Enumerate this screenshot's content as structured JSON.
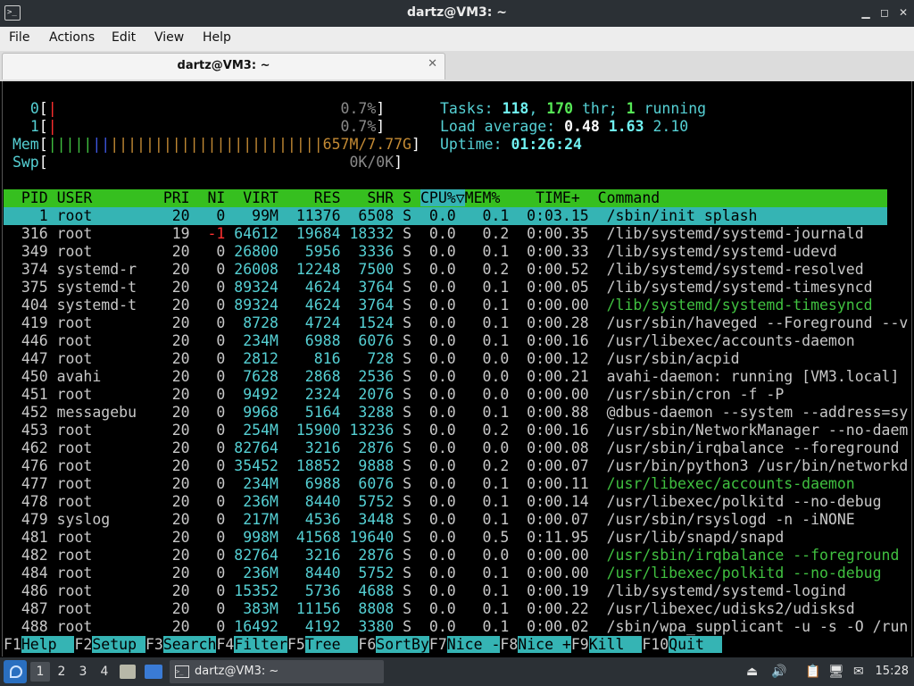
{
  "window": {
    "title": "dartz@VM3: ~",
    "icon": "terminal-icon",
    "minimize_glyph": "▁",
    "maximize_glyph": "◻",
    "close_glyph": "✕"
  },
  "menu": [
    "File",
    "Actions",
    "Edit",
    "View",
    "Help"
  ],
  "tab": {
    "label": "dartz@VM3: ~",
    "close_glyph": "✕"
  },
  "htop": {
    "cpu": [
      {
        "label": "0",
        "value": "0.7%"
      },
      {
        "label": "1",
        "value": "0.7%"
      }
    ],
    "mem": {
      "label": "Mem",
      "bar": "||||||||||||||||||||||||||||||||||||||",
      "value": "657M/7.77G"
    },
    "swp": {
      "label": "Swp",
      "value": "0K/0K"
    },
    "tasks": {
      "label": "Tasks: ",
      "count": "118",
      "threads": "170",
      "thr_label": " thr; ",
      "running": "1",
      "running_label": " running"
    },
    "load": {
      "label": "Load average: ",
      "one": "0.48",
      "five": "1.63",
      "fifteen": "2.10"
    },
    "uptime": {
      "label": "Uptime: ",
      "value": "01:26:24"
    },
    "columns": [
      "PID",
      "USER",
      "PRI",
      "NI",
      "VIRT",
      "RES",
      "SHR",
      "S",
      "CPU%",
      "MEM%",
      "TIME+",
      "Command"
    ],
    "sort_marker": "▽",
    "processes": [
      {
        "pid": "1",
        "user": "root",
        "pri": "20",
        "ni": "0",
        "virt": "99M",
        "res": "11376",
        "shr": "6508",
        "s": "S",
        "cpu": "0.0",
        "mem": "0.1",
        "time": "0:03.15",
        "cmd": "/sbin/init splash",
        "selected": true
      },
      {
        "pid": "316",
        "user": "root",
        "pri": "19",
        "ni": "-1",
        "virt": "64612",
        "res": "19684",
        "shr": "18332",
        "s": "S",
        "cpu": "0.0",
        "mem": "0.2",
        "time": "0:00.35",
        "cmd": "/lib/systemd/systemd-journald"
      },
      {
        "pid": "349",
        "user": "root",
        "pri": "20",
        "ni": "0",
        "virt": "26800",
        "res": "5956",
        "shr": "3336",
        "s": "S",
        "cpu": "0.0",
        "mem": "0.1",
        "time": "0:00.33",
        "cmd": "/lib/systemd/systemd-udevd"
      },
      {
        "pid": "374",
        "user": "systemd-r",
        "pri": "20",
        "ni": "0",
        "virt": "26008",
        "res": "12248",
        "shr": "7500",
        "s": "S",
        "cpu": "0.0",
        "mem": "0.2",
        "time": "0:00.52",
        "cmd": "/lib/systemd/systemd-resolved"
      },
      {
        "pid": "375",
        "user": "systemd-t",
        "pri": "20",
        "ni": "0",
        "virt": "89324",
        "res": "4624",
        "shr": "3764",
        "s": "S",
        "cpu": "0.0",
        "mem": "0.1",
        "time": "0:00.05",
        "cmd": "/lib/systemd/systemd-timesyncd"
      },
      {
        "pid": "404",
        "user": "systemd-t",
        "pri": "20",
        "ni": "0",
        "virt": "89324",
        "res": "4624",
        "shr": "3764",
        "s": "S",
        "cpu": "0.0",
        "mem": "0.1",
        "time": "0:00.00",
        "cmd": "/lib/systemd/systemd-timesyncd",
        "thread": true
      },
      {
        "pid": "419",
        "user": "root",
        "pri": "20",
        "ni": "0",
        "virt": "8728",
        "res": "4724",
        "shr": "1524",
        "s": "S",
        "cpu": "0.0",
        "mem": "0.1",
        "time": "0:00.28",
        "cmd": "/usr/sbin/haveged --Foreground --v"
      },
      {
        "pid": "446",
        "user": "root",
        "pri": "20",
        "ni": "0",
        "virt": "234M",
        "res": "6988",
        "shr": "6076",
        "s": "S",
        "cpu": "0.0",
        "mem": "0.1",
        "time": "0:00.16",
        "cmd": "/usr/libexec/accounts-daemon"
      },
      {
        "pid": "447",
        "user": "root",
        "pri": "20",
        "ni": "0",
        "virt": "2812",
        "res": "816",
        "shr": "728",
        "s": "S",
        "cpu": "0.0",
        "mem": "0.0",
        "time": "0:00.12",
        "cmd": "/usr/sbin/acpid"
      },
      {
        "pid": "450",
        "user": "avahi",
        "pri": "20",
        "ni": "0",
        "virt": "7628",
        "res": "2868",
        "shr": "2536",
        "s": "S",
        "cpu": "0.0",
        "mem": "0.0",
        "time": "0:00.21",
        "cmd": "avahi-daemon: running [VM3.local]"
      },
      {
        "pid": "451",
        "user": "root",
        "pri": "20",
        "ni": "0",
        "virt": "9492",
        "res": "2324",
        "shr": "2076",
        "s": "S",
        "cpu": "0.0",
        "mem": "0.0",
        "time": "0:00.00",
        "cmd": "/usr/sbin/cron -f -P"
      },
      {
        "pid": "452",
        "user": "messagebu",
        "pri": "20",
        "ni": "0",
        "virt": "9968",
        "res": "5164",
        "shr": "3288",
        "s": "S",
        "cpu": "0.0",
        "mem": "0.1",
        "time": "0:00.88",
        "cmd": "@dbus-daemon --system --address=sy"
      },
      {
        "pid": "453",
        "user": "root",
        "pri": "20",
        "ni": "0",
        "virt": "254M",
        "res": "15900",
        "shr": "13236",
        "s": "S",
        "cpu": "0.0",
        "mem": "0.2",
        "time": "0:00.16",
        "cmd": "/usr/sbin/NetworkManager --no-daem"
      },
      {
        "pid": "462",
        "user": "root",
        "pri": "20",
        "ni": "0",
        "virt": "82764",
        "res": "3216",
        "shr": "2876",
        "s": "S",
        "cpu": "0.0",
        "mem": "0.0",
        "time": "0:00.08",
        "cmd": "/usr/sbin/irqbalance --foreground"
      },
      {
        "pid": "476",
        "user": "root",
        "pri": "20",
        "ni": "0",
        "virt": "35452",
        "res": "18852",
        "shr": "9888",
        "s": "S",
        "cpu": "0.0",
        "mem": "0.2",
        "time": "0:00.07",
        "cmd": "/usr/bin/python3 /usr/bin/networkd"
      },
      {
        "pid": "477",
        "user": "root",
        "pri": "20",
        "ni": "0",
        "virt": "234M",
        "res": "6988",
        "shr": "6076",
        "s": "S",
        "cpu": "0.0",
        "mem": "0.1",
        "time": "0:00.11",
        "cmd": "/usr/libexec/accounts-daemon",
        "thread": true
      },
      {
        "pid": "478",
        "user": "root",
        "pri": "20",
        "ni": "0",
        "virt": "236M",
        "res": "8440",
        "shr": "5752",
        "s": "S",
        "cpu": "0.0",
        "mem": "0.1",
        "time": "0:00.14",
        "cmd": "/usr/libexec/polkitd --no-debug"
      },
      {
        "pid": "479",
        "user": "syslog",
        "pri": "20",
        "ni": "0",
        "virt": "217M",
        "res": "4536",
        "shr": "3448",
        "s": "S",
        "cpu": "0.0",
        "mem": "0.1",
        "time": "0:00.07",
        "cmd": "/usr/sbin/rsyslogd -n -iNONE"
      },
      {
        "pid": "481",
        "user": "root",
        "pri": "20",
        "ni": "0",
        "virt": "998M",
        "res": "41568",
        "shr": "19640",
        "s": "S",
        "cpu": "0.0",
        "mem": "0.5",
        "time": "0:11.95",
        "cmd": "/usr/lib/snapd/snapd"
      },
      {
        "pid": "482",
        "user": "root",
        "pri": "20",
        "ni": "0",
        "virt": "82764",
        "res": "3216",
        "shr": "2876",
        "s": "S",
        "cpu": "0.0",
        "mem": "0.0",
        "time": "0:00.00",
        "cmd": "/usr/sbin/irqbalance --foreground",
        "thread": true
      },
      {
        "pid": "484",
        "user": "root",
        "pri": "20",
        "ni": "0",
        "virt": "236M",
        "res": "8440",
        "shr": "5752",
        "s": "S",
        "cpu": "0.0",
        "mem": "0.1",
        "time": "0:00.00",
        "cmd": "/usr/libexec/polkitd --no-debug",
        "thread": true
      },
      {
        "pid": "486",
        "user": "root",
        "pri": "20",
        "ni": "0",
        "virt": "15352",
        "res": "5736",
        "shr": "4688",
        "s": "S",
        "cpu": "0.0",
        "mem": "0.1",
        "time": "0:00.19",
        "cmd": "/lib/systemd/systemd-logind"
      },
      {
        "pid": "487",
        "user": "root",
        "pri": "20",
        "ni": "0",
        "virt": "383M",
        "res": "11156",
        "shr": "8808",
        "s": "S",
        "cpu": "0.0",
        "mem": "0.1",
        "time": "0:00.22",
        "cmd": "/usr/libexec/udisks2/udisksd"
      },
      {
        "pid": "488",
        "user": "root",
        "pri": "20",
        "ni": "0",
        "virt": "16492",
        "res": "4192",
        "shr": "3380",
        "s": "S",
        "cpu": "0.0",
        "mem": "0.1",
        "time": "0:00.02",
        "cmd": "/sbin/wpa_supplicant -u -s -O /run"
      }
    ],
    "fkeys": [
      {
        "key": "F1",
        "label": "Help  "
      },
      {
        "key": "F2",
        "label": "Setup "
      },
      {
        "key": "F3",
        "label": "Search"
      },
      {
        "key": "F4",
        "label": "Filter"
      },
      {
        "key": "F5",
        "label": "Tree  "
      },
      {
        "key": "F6",
        "label": "SortBy"
      },
      {
        "key": "F7",
        "label": "Nice -"
      },
      {
        "key": "F8",
        "label": "Nice +"
      },
      {
        "key": "F9",
        "label": "Kill  "
      },
      {
        "key": "F10",
        "label": "Quit  "
      }
    ]
  },
  "taskbar": {
    "workspaces": [
      "1",
      "2",
      "3",
      "4"
    ],
    "active_workspace": "1",
    "task_label": "dartz@VM3: ~",
    "clock": "15:28",
    "tray_icons": [
      "eject-icon",
      "volume-icon",
      "clipboard-icon",
      "network-icon",
      "notification-icon"
    ]
  },
  "colors": {
    "header_bg": "#36bf1f",
    "selected_bg": "#35b4b4",
    "titlebar_bg": "#2b3035",
    "thread_text": "#40c040"
  }
}
